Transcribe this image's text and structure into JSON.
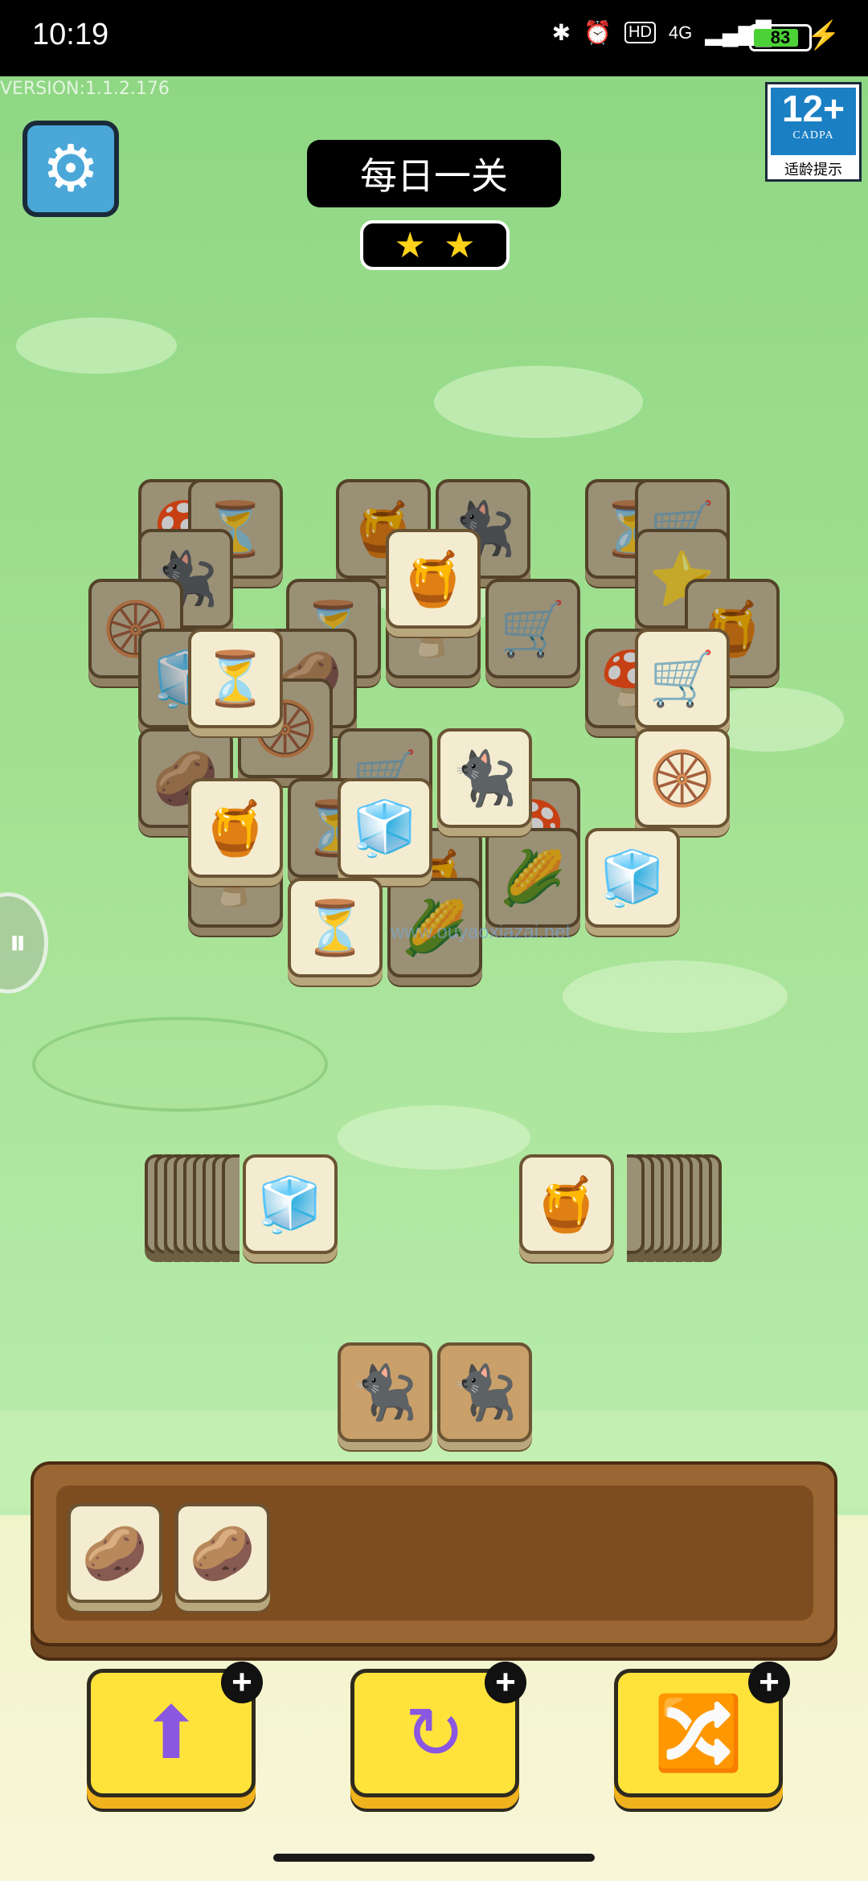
{
  "status_bar": {
    "time": "10:19",
    "network": "4G",
    "hd": "HD",
    "battery": "83",
    "battery_level": 0.83
  },
  "game": {
    "version": "VERSION:1.1.2.176",
    "title": "每日一关",
    "stars": [
      "★",
      "★"
    ],
    "age_rating": {
      "value": "12+",
      "org": "CADPA",
      "tip": "适龄提示"
    },
    "watermark": "www.ouyaoxiazai.net"
  },
  "icons": {
    "settings": "⚙",
    "side": "⏸",
    "jar": "🍯",
    "cat": "🐈‍⬛",
    "hourglass": "⏳",
    "ice": "🧊",
    "tire": "🛞",
    "potato": "🥔",
    "mushroom": "🍄",
    "star": "⭐",
    "cart": "🛒",
    "corn": "🌽",
    "tool_move": "⬆",
    "tool_undo": "↻",
    "tool_shuffle": "🔀",
    "plus": "+"
  },
  "board": {
    "top_tiles": [
      {
        "icon": "🍯",
        "dim": false
      },
      {
        "icon": "⏳",
        "dim": false
      },
      {
        "icon": "🛒",
        "dim": false
      },
      {
        "icon": "🛞",
        "dim": false
      },
      {
        "icon": "🍯",
        "dim": false
      },
      {
        "icon": "🧊",
        "dim": false
      },
      {
        "icon": "🐈‍⬛",
        "dim": false
      },
      {
        "icon": "🧊",
        "dim": false
      },
      {
        "icon": "⏳",
        "dim": false
      }
    ],
    "back_tiles": [
      {
        "icon": "🍄",
        "dim": true
      },
      {
        "icon": "⏳",
        "dim": true
      },
      {
        "icon": "🍯",
        "dim": true
      },
      {
        "icon": "🐈‍⬛",
        "dim": true
      },
      {
        "icon": "⏳",
        "dim": true
      },
      {
        "icon": "🛒",
        "dim": true
      },
      {
        "icon": "🐈‍⬛",
        "dim": true
      },
      {
        "icon": "⭐",
        "dim": true
      },
      {
        "icon": "🛞",
        "dim": true
      },
      {
        "icon": "⏳",
        "dim": true
      },
      {
        "icon": "🛒",
        "dim": true
      },
      {
        "icon": "🍯",
        "dim": true
      },
      {
        "icon": "🧊",
        "dim": true
      },
      {
        "icon": "🥔",
        "dim": true
      },
      {
        "icon": "🍄",
        "dim": true
      },
      {
        "icon": "🍄",
        "dim": true
      },
      {
        "icon": "🥔",
        "dim": true
      },
      {
        "icon": "🛞",
        "dim": true
      },
      {
        "icon": "🛒",
        "dim": true
      },
      {
        "icon": "⏳",
        "dim": true
      },
      {
        "icon": "🍄",
        "dim": true
      },
      {
        "icon": "🍯",
        "dim": true
      },
      {
        "icon": "🌽",
        "dim": true
      },
      {
        "icon": "🌽",
        "dim": true
      },
      {
        "icon": "🍄",
        "dim": true
      }
    ],
    "left_stack": {
      "top_icon": "🧊"
    },
    "right_stack": {
      "top_icon": "🍯"
    },
    "bottom_pair": [
      "🐈‍⬛",
      "🐈‍⬛"
    ]
  },
  "tray": {
    "slots": [
      "🥔",
      "🥔"
    ]
  }
}
